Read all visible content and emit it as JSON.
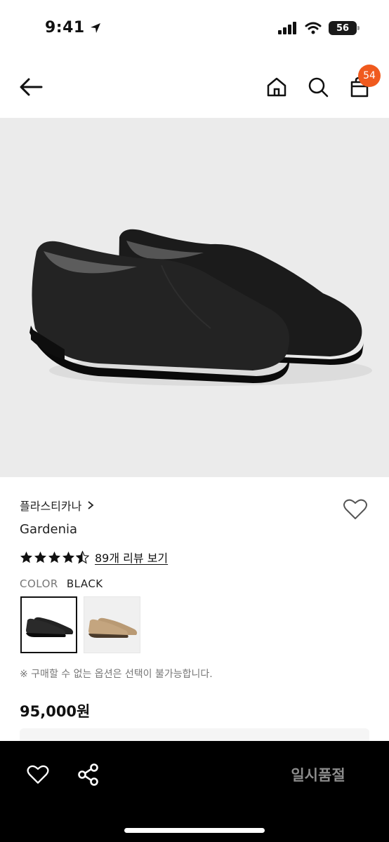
{
  "status_bar": {
    "time": "9:41",
    "battery": "56"
  },
  "nav": {
    "cart_count": "54"
  },
  "product": {
    "brand": "플라스티카나",
    "name": "Gardenia",
    "review_link": "89개 리뷰 보기",
    "color_label": "COLOR",
    "color_value": "BLACK",
    "option_note": "※ 구매할 수 없는 옵션은 선택이 불가능합니다.",
    "price": "95,000원"
  },
  "rating": {
    "value": 4.5,
    "max": 5
  },
  "bottom": {
    "status_button": "일시품절"
  },
  "colors": {
    "accent": "#f05a1e",
    "bottom_bar": "#000000",
    "image_bg": "#ebebeb"
  }
}
